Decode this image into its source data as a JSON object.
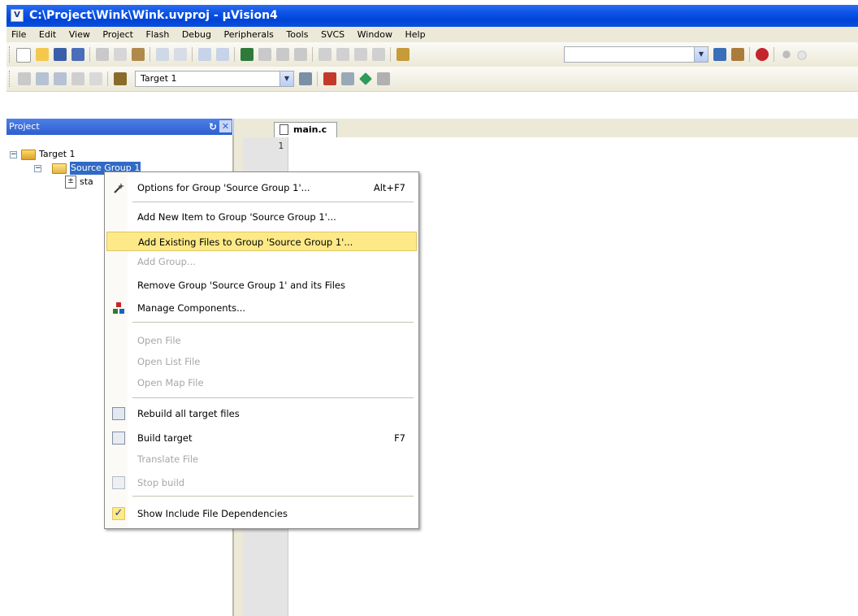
{
  "window": {
    "title": "C:\\Project\\Wink\\Wink.uvproj - µVision4"
  },
  "menubar": [
    "File",
    "Edit",
    "View",
    "Project",
    "Flash",
    "Debug",
    "Peripherals",
    "Tools",
    "SVCS",
    "Window",
    "Help"
  ],
  "toolbar2": {
    "target_select": "Target 1"
  },
  "project_panel": {
    "title": "Project",
    "tree": {
      "target": "Target 1",
      "group": "Source Group 1",
      "file": "sta"
    }
  },
  "editor": {
    "tab": "main.c",
    "line_number": "1"
  },
  "context_menu": {
    "items": [
      {
        "label": "Options for Group 'Source Group 1'...",
        "shortcut": "Alt+F7"
      },
      {
        "label": "Add New  Item to Group 'Source Group 1'..."
      },
      {
        "label": "Add Existing Files to Group 'Source Group 1'..."
      },
      {
        "label": "Add Group..."
      },
      {
        "label": "Remove Group 'Source Group 1' and its Files"
      },
      {
        "label": "Manage Components..."
      },
      {
        "label": "Open File"
      },
      {
        "label": "Open List File"
      },
      {
        "label": "Open Map File"
      },
      {
        "label": "Rebuild all target files"
      },
      {
        "label": "Build target",
        "shortcut": "F7"
      },
      {
        "label": "Translate File"
      },
      {
        "label": "Stop build"
      },
      {
        "label": "Show Include File Dependencies"
      }
    ],
    "highlight_color": "#fde987"
  }
}
